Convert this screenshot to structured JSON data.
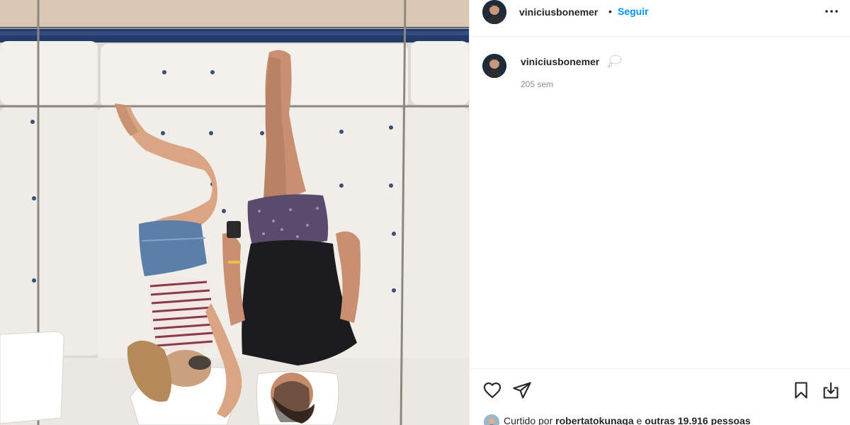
{
  "post": {
    "author": "viniciusbonemer",
    "separator": "•",
    "follow_label": "Seguir",
    "more_icon": "more-horizontal-icon"
  },
  "photo": {
    "description_icon": "photo"
  },
  "caption": {
    "username": "viniciusbonemer",
    "emoji": "thought-balloon-icon",
    "time": "205 sem"
  },
  "actions": {
    "like_icon": "heart-icon",
    "share_icon": "paper-plane-icon",
    "save_icon": "bookmark-icon",
    "download_icon": "download-icon"
  },
  "likes": {
    "prefix": "Curtido por",
    "user": "robertatokunaga",
    "middle": "e",
    "others": "outras 19.916 pessoas"
  },
  "colors": {
    "link": "#0095f6",
    "text": "#262626",
    "muted": "#8e8e8e",
    "border": "#efefef"
  }
}
